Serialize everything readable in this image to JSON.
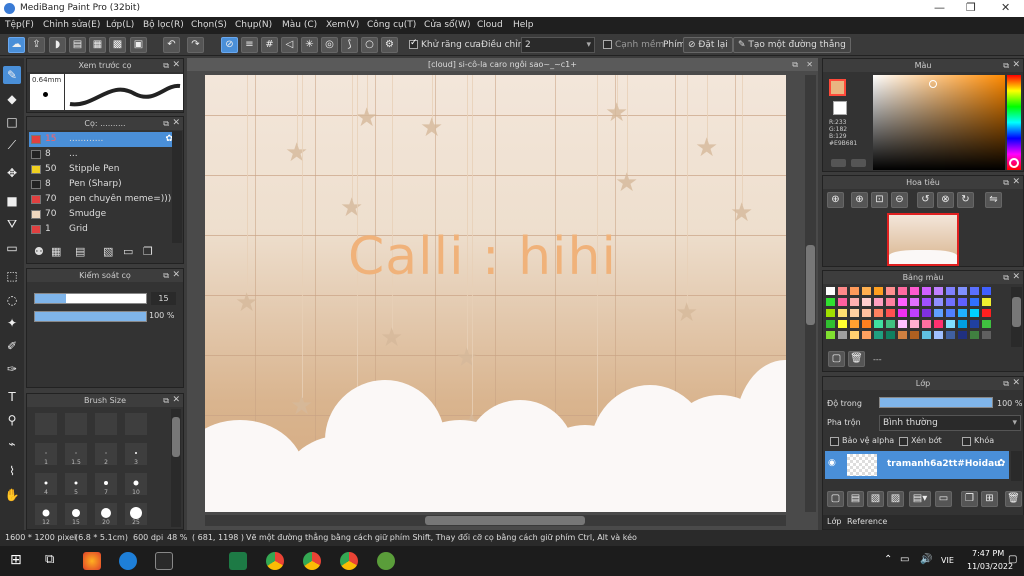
{
  "app": {
    "title": "MediBang Paint Pro (32bit)"
  },
  "menu": [
    "Tệp(F)",
    "Chỉnh sửa(E)",
    "Lớp(L)",
    "Bộ lọc(R)",
    "Chọn(S)",
    "Chụp(N)",
    "Màu (C)",
    "Xem(V)",
    "Công cụ(T)",
    "Cửa sổ(W)",
    "Cloud",
    "Help"
  ],
  "toolbar": {
    "antialias_label": "Khử răng cưa",
    "adjust_label": "Điều chỉnh",
    "adjust_value": "2",
    "snap_label": "Cạnh mềm",
    "pen_label": "Phím",
    "reset_label": "Đặt lại",
    "straight_label": "Tạo một đường thẳng"
  },
  "preview_panel": {
    "title": "Xem trước cọ",
    "size": "0.64mm"
  },
  "brush_panel": {
    "title": "Cọ: ..........",
    "items": [
      {
        "num": "15",
        "name": "............",
        "color": "#e04040",
        "selected": true
      },
      {
        "num": "8",
        "name": "...",
        "color": "#222222"
      },
      {
        "num": "50",
        "name": "Stipple Pen",
        "color": "#f0d020"
      },
      {
        "num": "8",
        "name": "Pen (Sharp)",
        "color": "#222222"
      },
      {
        "num": "70",
        "name": "pen chuyên meme=)))",
        "color": "#e04040"
      },
      {
        "num": "70",
        "name": "Smudge",
        "color": "#f0d8c0"
      },
      {
        "num": "1",
        "name": "Grid",
        "color": "#e04040"
      }
    ]
  },
  "brush_control": {
    "title": "Kiểm soát cọ",
    "size_value": "15",
    "size_fraction": 0.28,
    "opacity_value": "100 %",
    "opacity_fraction": 1.0
  },
  "brush_size": {
    "title": "Brush Size",
    "rows": [
      [
        "",
        "",
        "",
        ""
      ],
      [
        "1",
        "1.5",
        "2",
        "3"
      ],
      [
        "4",
        "5",
        "7",
        "10"
      ],
      [
        "12",
        "15",
        "20",
        "25"
      ]
    ]
  },
  "document": {
    "tab": "[cloud] si-cô-la caro ngôi sao~_~c1+",
    "text": "Calli : hihi"
  },
  "color_panel": {
    "title": "Màu",
    "r": "R:233",
    "g": "G:182",
    "b": "B:129",
    "hex": "#E9B681",
    "fg": "#e9b681"
  },
  "navigator": {
    "title": "Hoa tiêu"
  },
  "palette": {
    "title": "Bảng màu",
    "colors": [
      "#ffffff",
      "#ff8a8a",
      "#ff9a5a",
      "#ffb050",
      "#ffa020",
      "#ff9090",
      "#ff6aa0",
      "#ff5ad0",
      "#d060ff",
      "#c080ff",
      "#8080ff",
      "#8090ff",
      "#5a70ff",
      "#4060ff",
      "#30e030",
      "#ff60a0",
      "#ffb0b0",
      "#ffd0d0",
      "#ffa0c0",
      "#ff80a0",
      "#ff60ff",
      "#e070ff",
      "#a050ff",
      "#9090ff",
      "#7070ff",
      "#6060ff",
      "#3070ff",
      "#f0f030",
      "#a0e000",
      "#ffe070",
      "#ffd0a0",
      "#ffc0a0",
      "#ff8060",
      "#ff5050",
      "#f030f0",
      "#c040ff",
      "#8030e0",
      "#60a0ff",
      "#5080ff",
      "#20b0ff",
      "#00d0ff",
      "#ff2020",
      "#30c030",
      "#ffff30",
      "#ffa030",
      "#ff8020",
      "#40e0a0",
      "#40c080",
      "#ffc0ff",
      "#ffb0d0",
      "#ff70a0",
      "#ff3070",
      "#80e0ff",
      "#00a0e0",
      "#2040a0",
      "#40c040",
      "#80e030",
      "#a0a0a0",
      "#ffd070",
      "#ffa060",
      "#20a080",
      "#108060",
      "#d08040",
      "#b06020",
      "#60c0e0",
      "#a0c0ff",
      "#4060a0",
      "#203080",
      "#408040",
      "#606060"
    ]
  },
  "layer_panel": {
    "title": "Lớp",
    "opacity_label": "Độ trong",
    "opacity_value": "100 %",
    "blend_label": "Pha trộn",
    "blend_value": "Bình thường",
    "protect_alpha": "Bảo vệ alpha",
    "clip": "Xén bớt",
    "lock": "Khóa",
    "layer_name": "tramanh6a2tt#Hoidau",
    "tabs": [
      "Lớp",
      "Reference"
    ]
  },
  "status": {
    "size": "1600 * 1200 pixel",
    "cm": "(6.8 * 5.1cm)",
    "dpi": "600 dpi",
    "zoom": "48 %",
    "coords": "( 681, 1198 )",
    "hint": "Vẽ một đường thẳng bằng cách giữ phím Shift, Thay đổi cỡ cọ bằng cách giữ phím Ctrl, Alt và kéo"
  },
  "taskbar": {
    "lang": "VIE",
    "time": "7:47 PM",
    "date": "11/03/2022"
  }
}
